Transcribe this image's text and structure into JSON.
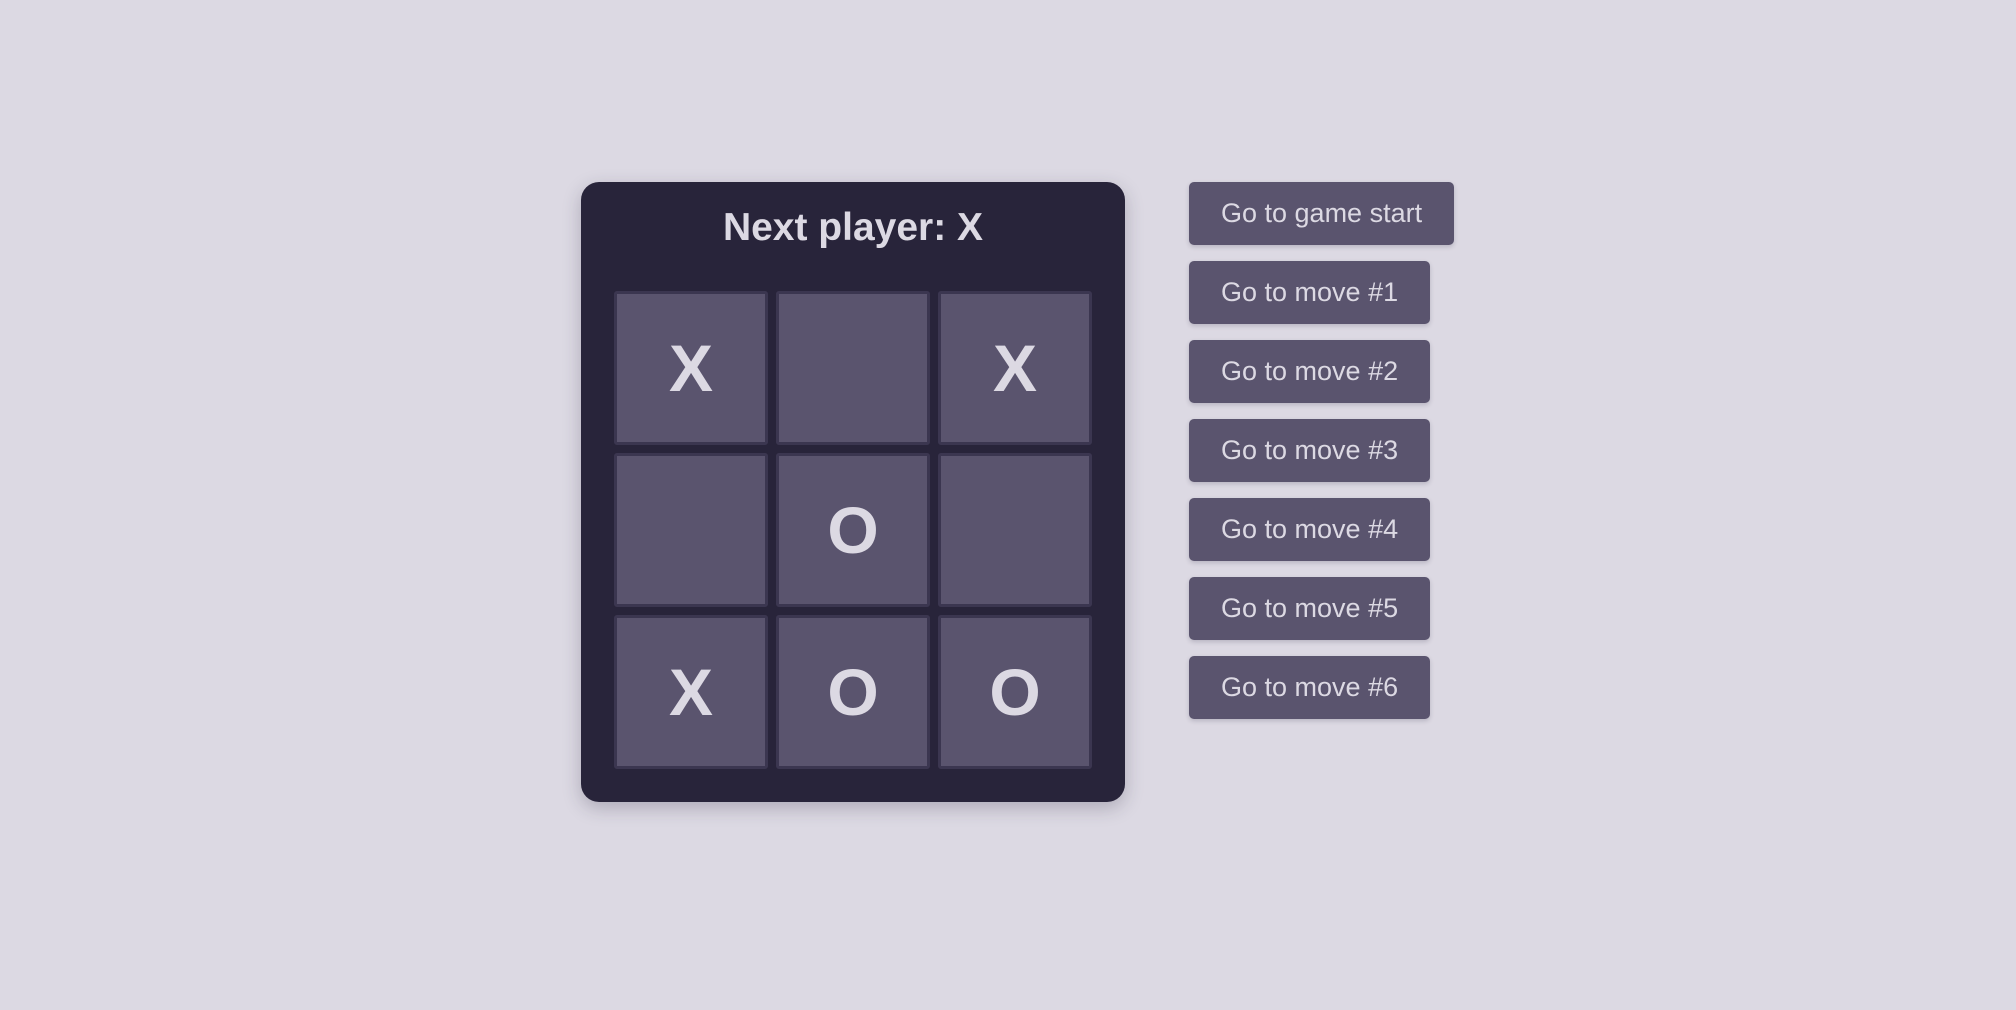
{
  "game": {
    "status": "Next player: X",
    "squares": [
      "X",
      "",
      "X",
      "",
      "O",
      "",
      "X",
      "O",
      "O"
    ]
  },
  "history": {
    "buttons": [
      "Go to game start",
      "Go to move #1",
      "Go to move #2",
      "Go to move #3",
      "Go to move #4",
      "Go to move #5",
      "Go to move #6"
    ]
  },
  "colors": {
    "background": "#dcd9e3",
    "card": "#28243a",
    "square": "#5a546e",
    "text": "#dcd9e3"
  }
}
